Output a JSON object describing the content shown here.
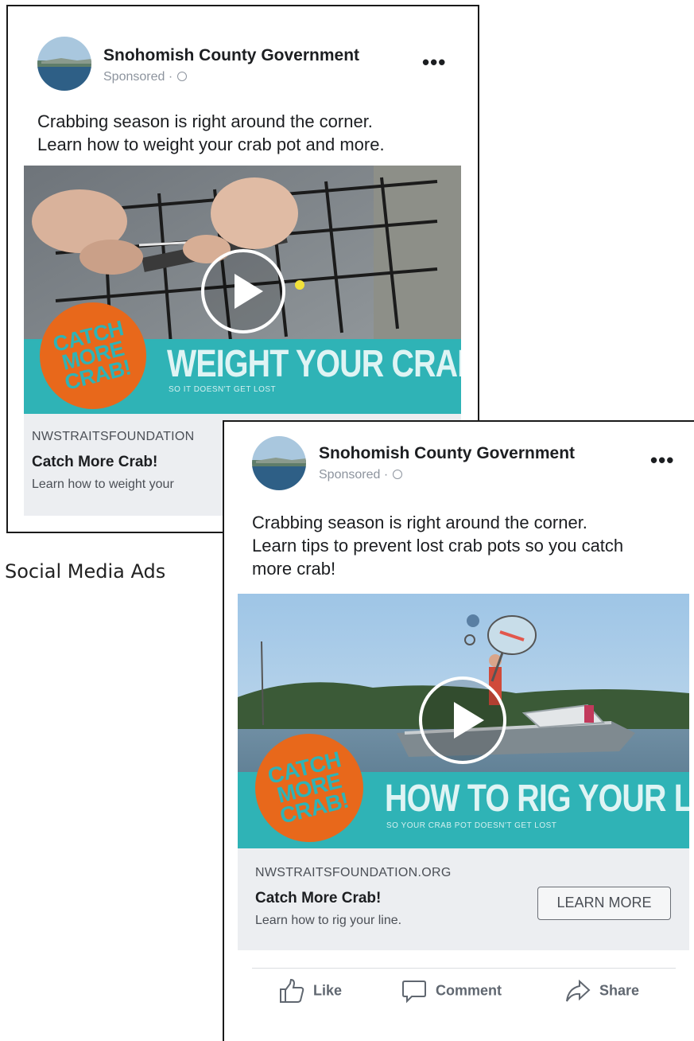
{
  "ad1": {
    "page_name": "Snohomish County Government",
    "sponsored": "Sponsored ·",
    "more": "•••",
    "text_lines": [
      "Crabbing season is right around the corner.",
      "Learn how to weight your crab pot and more."
    ],
    "badge": [
      "CATCH",
      "MORE",
      "CRAB!"
    ],
    "banner_title": "WEIGHT YOUR CRAB POT",
    "banner_sub": "SO IT DOESN'T GET LOST",
    "domain": "NWSTRAITSFOUNDATION",
    "headline": "Catch More Crab!",
    "description": "Learn how to weight your"
  },
  "ad2": {
    "page_name": "Snohomish County Government",
    "sponsored": "Sponsored ·",
    "more": "•••",
    "text_lines": [
      "Crabbing season is right around the corner.",
      "Learn tips to prevent lost crab pots so you catch",
      "more crab!"
    ],
    "badge": [
      "CATCH",
      "MORE",
      "CRAB!"
    ],
    "banner_title": "HOW TO RIG YOUR LINE",
    "banner_sub": "SO YOUR CRAB POT DOESN'T GET LOST",
    "domain": "NWSTRAITSFOUNDATION.ORG",
    "headline": "Catch More Crab!",
    "description": "Learn how to rig your line.",
    "cta": "LEARN MORE",
    "actions": {
      "like": "Like",
      "comment": "Comment",
      "share": "Share"
    }
  },
  "caption": "Social Media Ads",
  "colors": {
    "teal": "#2fb3b6",
    "orange": "#e8681b",
    "link_bg": "#eceef1",
    "text": "#1c1e21",
    "muted": "#8d949e"
  }
}
